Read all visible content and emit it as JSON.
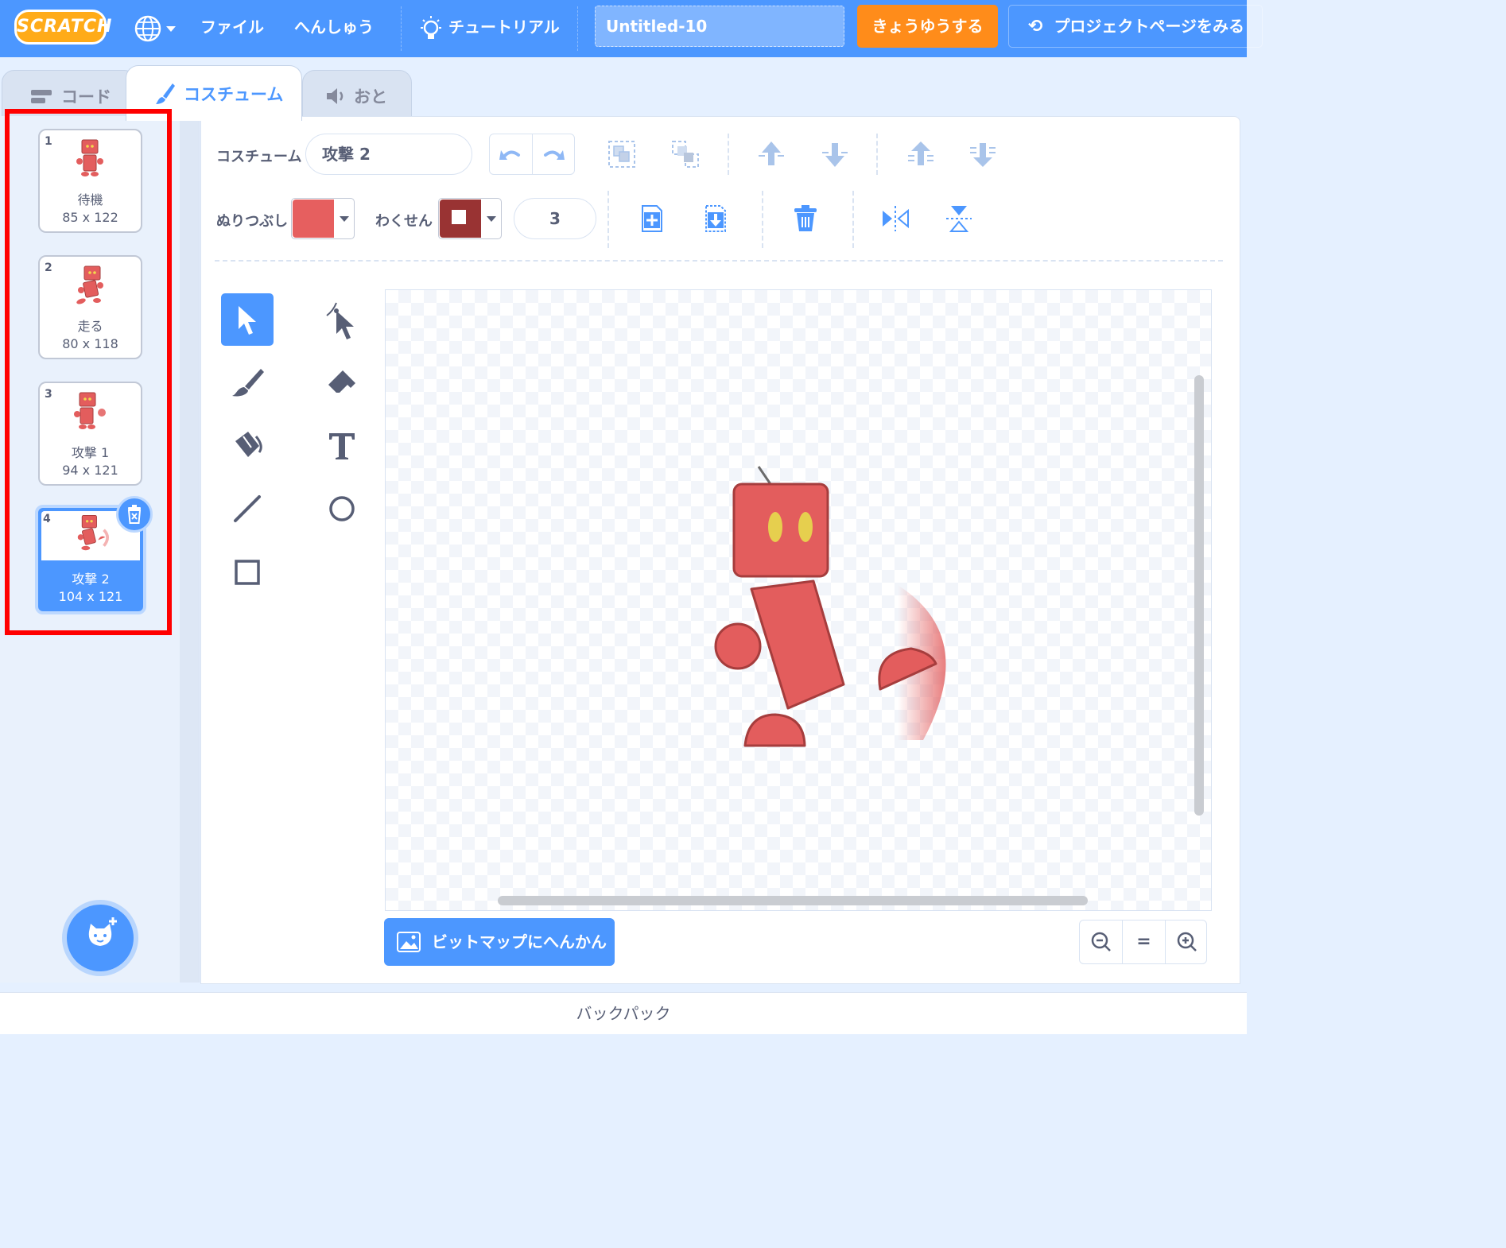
{
  "menubar": {
    "logo": "SCRATCH",
    "file": "ファイル",
    "edit": "へんしゅう",
    "tutorials": "チュートリアル",
    "project_title": "Untitled-10",
    "share": "きょうゆうする",
    "see_project_page": "プロジェクトページをみる"
  },
  "tabs": [
    {
      "label": "コード"
    },
    {
      "label": "コスチューム"
    },
    {
      "label": "おと"
    }
  ],
  "costumes": [
    {
      "number": "1",
      "name": "待機",
      "size": "85 x 122"
    },
    {
      "number": "2",
      "name": "走る",
      "size": "80 x 118"
    },
    {
      "number": "3",
      "name": "攻撃 1",
      "size": "94 x 121"
    },
    {
      "number": "4",
      "name": "攻撃 2",
      "size": "104 x 121",
      "selected": true
    }
  ],
  "editor": {
    "costume_label": "コスチューム",
    "costume_name": "攻撃 2",
    "fill_label": "ぬりつぶし",
    "fill_color": "#e65f5f",
    "outline_label": "わくせん",
    "outline_color": "#993333",
    "outline_width": "3",
    "convert_button": "ビットマップにへんかん",
    "zoom_reset": "="
  },
  "backpack": "バックパック",
  "colors": {
    "accent": "#4c97ff",
    "share": "#ff8c1a",
    "highlight": "#ff0000",
    "robot": "#e35d5d"
  }
}
